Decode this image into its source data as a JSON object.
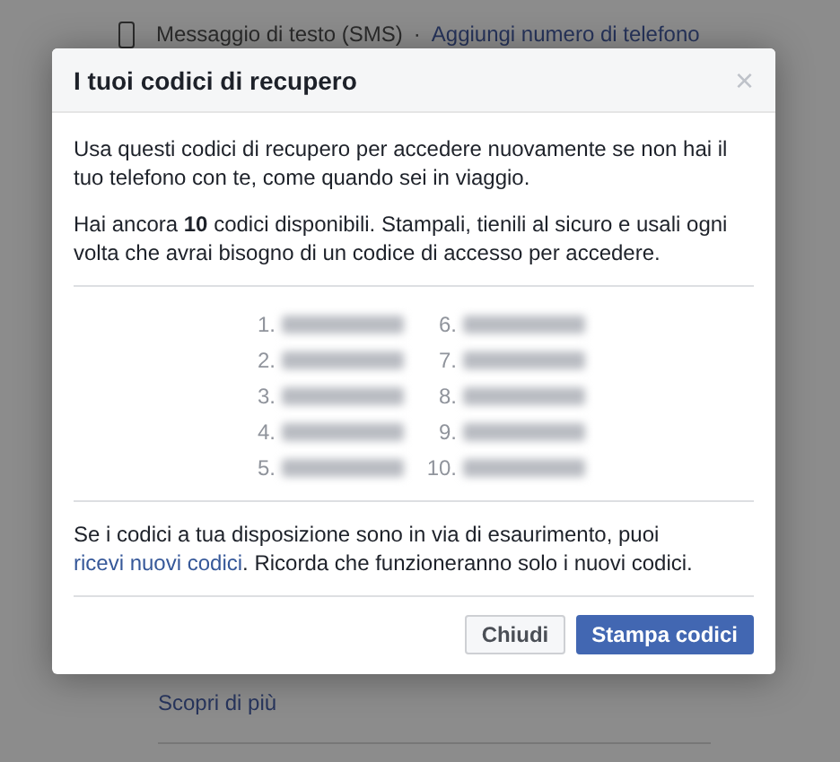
{
  "background_page": {
    "method_label": "Messaggio di testo (SMS)",
    "separator": "·",
    "add_phone_link": "Aggiungi numero di telefono",
    "learn_more_link": "Scopri di più"
  },
  "dialog": {
    "title": "I tuoi codici di recupero",
    "close": "×",
    "intro": "Usa questi codici di recupero per accedere nuovamente se non hai il tuo telefono con te, come quando sei in viaggio.",
    "count_text": "Hai ancora **10** codici disponibili. Stampali, tienili al sicuro e usali ogni volta che avrai bisogno di un codice di accesso per accedere.",
    "codes": [
      {
        "number": "1."
      },
      {
        "number": "2."
      },
      {
        "number": "3."
      },
      {
        "number": "4."
      },
      {
        "number": "5."
      },
      {
        "number": "6."
      },
      {
        "number": "7."
      },
      {
        "number": "8."
      },
      {
        "number": "9."
      },
      {
        "number": "10."
      }
    ],
    "footer_before": "Se i codici a tua disposizione sono in via di esaurimento, puoi",
    "footer_link": "ricevi nuovi codici",
    "footer_after": ". Ricorda che funzioneranno solo i nuovi codici.",
    "buttons": [
      {
        "label": "Chiudi",
        "kind": "secondary"
      },
      {
        "label": "Stampa codici",
        "kind": "primary"
      }
    ]
  }
}
